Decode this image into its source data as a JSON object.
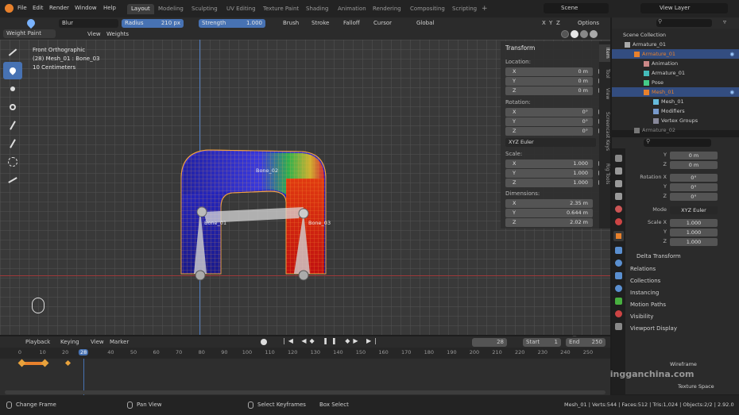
{
  "menu": [
    "File",
    "Edit",
    "Render",
    "Window",
    "Help"
  ],
  "workspaces": [
    "Layout",
    "Modeling",
    "Sculpting",
    "UV Editing",
    "Texture Paint",
    "Shading",
    "Animation",
    "Rendering",
    "Compositing",
    "Scripting"
  ],
  "scene": "Scene",
  "view_layer": "View Layer",
  "tool_header": {
    "brush": "Blur",
    "radius_label": "Radius",
    "radius_value": "210 px",
    "strength_label": "Strength",
    "strength_value": "1.000",
    "menus": [
      "Brush",
      "Stroke",
      "Falloff",
      "Cursor"
    ],
    "orientation": "Global",
    "axes": [
      "X",
      "Y",
      "Z"
    ],
    "options": "Options"
  },
  "viewport_header": {
    "mode": "Weight Paint",
    "menus": [
      "View",
      "Weights"
    ]
  },
  "viewport_overlay": {
    "line1": "Front Orthographic",
    "line2": "(28) Mesh_01 : Bone_03",
    "line3": "10 Centimeters"
  },
  "bones": [
    "Bone_01",
    "Bone_02",
    "Bone_03"
  ],
  "npanel": {
    "title": "Transform",
    "location_label": "Location:",
    "location": [
      {
        "k": "X",
        "v": "0 m"
      },
      {
        "k": "Y",
        "v": "0 m"
      },
      {
        "k": "Z",
        "v": "0 m"
      }
    ],
    "rotation_label": "Rotation:",
    "rotation": [
      {
        "k": "X",
        "v": "0°"
      },
      {
        "k": "Y",
        "v": "0°"
      },
      {
        "k": "Z",
        "v": "0°"
      }
    ],
    "rotation_mode": "XYZ Euler",
    "scale_label": "Scale:",
    "scale": [
      {
        "k": "X",
        "v": "1.000"
      },
      {
        "k": "Y",
        "v": "1.000"
      },
      {
        "k": "Z",
        "v": "1.000"
      }
    ],
    "dimensions_label": "Dimensions:",
    "dimensions": [
      {
        "k": "X",
        "v": "2.35 m"
      },
      {
        "k": "Y",
        "v": "0.644 m"
      },
      {
        "k": "Z",
        "v": "2.02 m"
      }
    ],
    "tabs": [
      "Item",
      "Tool",
      "View",
      "Screencast Keys",
      "Rig Tools"
    ]
  },
  "outliner": {
    "rows": [
      {
        "label": "Scene Collection",
        "indent": 0
      },
      {
        "label": "Armature_01",
        "indent": 1
      },
      {
        "label": "Armature_01",
        "indent": 2
      },
      {
        "label": "Animation",
        "indent": 3
      },
      {
        "label": "Armature_01",
        "indent": 3
      },
      {
        "label": "Pose",
        "indent": 3
      },
      {
        "label": "Mesh_01",
        "indent": 3
      },
      {
        "label": "Mesh_01",
        "indent": 4
      },
      {
        "label": "Modifiers",
        "indent": 4
      },
      {
        "label": "Vertex Groups",
        "indent": 4
      },
      {
        "label": "Armature_02",
        "indent": 2
      }
    ]
  },
  "properties": {
    "location": [
      {
        "k": "Y",
        "v": "0 m"
      },
      {
        "k": "Z",
        "v": "0 m"
      }
    ],
    "rotation_label": "Rotation X",
    "rotation": [
      {
        "k": "Rotation X",
        "v": "0°"
      },
      {
        "k": "Y",
        "v": "0°"
      },
      {
        "k": "Z",
        "v": "0°"
      }
    ],
    "mode_label": "Mode",
    "mode_value": "XYZ Euler",
    "scale": [
      {
        "k": "Scale X",
        "v": "1.000"
      },
      {
        "k": "Y",
        "v": "1.000"
      },
      {
        "k": "Z",
        "v": "1.000"
      }
    ],
    "sections": [
      "Delta Transform",
      "Relations",
      "Collections",
      "Instancing",
      "Motion Paths",
      "Visibility",
      "Viewport Display"
    ],
    "viewport_display_items": [
      "Wireframe",
      "Texture Space"
    ]
  },
  "timeline": {
    "menus": [
      "Playback",
      "Keying",
      "View",
      "Marker"
    ],
    "current_frame": "28",
    "start_label": "Start",
    "start_value": "1",
    "end_label": "End",
    "end_value": "250",
    "ticks": [
      "0",
      "10",
      "20",
      "28",
      "40",
      "50",
      "60",
      "70",
      "80",
      "90",
      "100",
      "110",
      "120",
      "130",
      "140",
      "150",
      "160",
      "170",
      "180",
      "190",
      "200",
      "210",
      "220",
      "230",
      "240",
      "250"
    ]
  },
  "status": {
    "change_frame": "Change Frame",
    "pan_view": "Pan View",
    "select_keyframes": "Select Keyframes",
    "box_select": "Box Select",
    "stats": "Mesh_01 | Verts:544 | Faces:512 | Tris:1,024 | Objects:2/2 | 2.92.0"
  },
  "watermark": "lingganchina.com",
  "colors": {
    "accent_blue": "#4772b3",
    "selected_row": "#334d80",
    "object_orange": "#e8812c",
    "keyframe_orange": "#e8a23c"
  }
}
